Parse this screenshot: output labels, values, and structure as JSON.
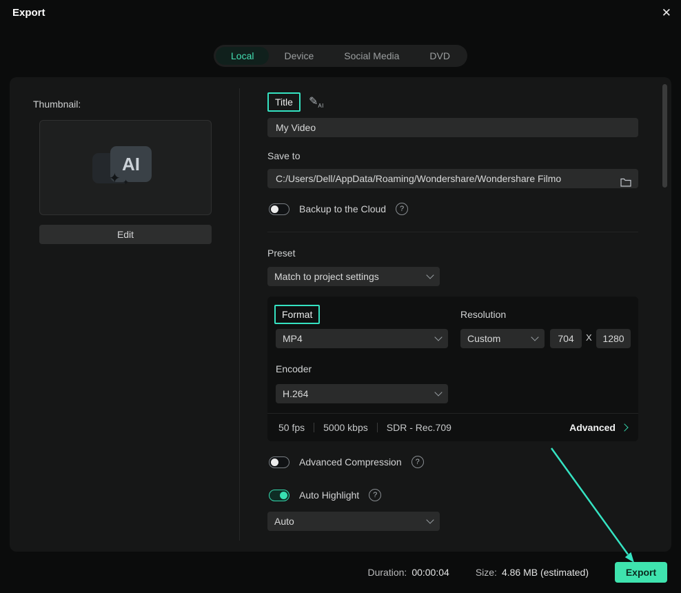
{
  "colors": {
    "accent": "#3fe3ae",
    "annotation": "#35e3c2"
  },
  "glyphs": {
    "close": "✕",
    "help": "?",
    "spark": "✦",
    "x_sep": "X"
  },
  "header": {
    "title": "Export"
  },
  "tabs": [
    {
      "label": "Local",
      "active": true
    },
    {
      "label": "Device",
      "active": false
    },
    {
      "label": "Social Media",
      "active": false
    },
    {
      "label": "DVD",
      "active": false
    }
  ],
  "left": {
    "thumbnail_label": "Thumbnail:",
    "logo_text": "AI",
    "edit_button": "Edit"
  },
  "right": {
    "title_label": "Title",
    "title_value": "My Video",
    "save_to_label": "Save to",
    "save_path": "C:/Users/Dell/AppData/Roaming/Wondershare/Wondershare Filmo",
    "backup_label": "Backup to the Cloud",
    "preset_label": "Preset",
    "preset_value": "Match to project settings",
    "format_label": "Format",
    "format_value": "MP4",
    "resolution_label": "Resolution",
    "resolution_value": "Custom",
    "width_value": "704",
    "height_value": "1280",
    "encoder_label": "Encoder",
    "encoder_value": "H.264",
    "fps": "50 fps",
    "bitrate": "5000 kbps",
    "colorspace": "SDR - Rec.709",
    "advanced_link": "Advanced",
    "advanced_compression_label": "Advanced Compression",
    "auto_highlight_label": "Auto Highlight",
    "auto_highlight_value": "Auto"
  },
  "footer": {
    "duration_label": "Duration:",
    "duration_value": "00:00:04",
    "size_label": "Size:",
    "size_value": "4.86 MB (estimated)",
    "export_button": "Export"
  }
}
